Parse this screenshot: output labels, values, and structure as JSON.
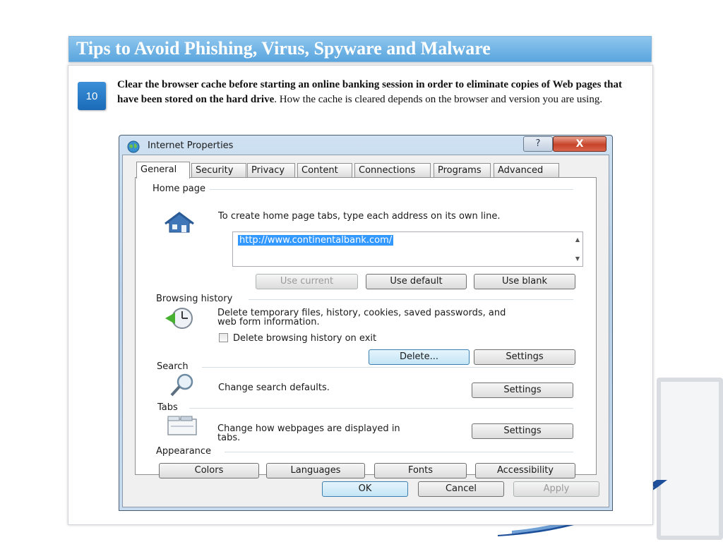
{
  "slide": {
    "title": "Tips to Avoid Phishing, Virus, Spyware and Malware",
    "tip_number": "10",
    "tip_bold": "Clear the browser cache before starting an online banking session in order to eliminate copies of Web pages that have been stored on the hard drive",
    "tip_rest": ". How the cache is cleared depends on the browser and version you are using."
  },
  "dialog": {
    "title": "Internet Properties",
    "help_button": "?",
    "close_button": "X",
    "tabs": [
      "General",
      "Security",
      "Privacy",
      "Content",
      "Connections",
      "Programs",
      "Advanced"
    ],
    "active_tab": "General",
    "home_page": {
      "label": "Home page",
      "instruction": "To create home page tabs, type each address on its own line.",
      "url": "http://www.continentalbank.com/",
      "use_current": "Use current",
      "use_default": "Use default",
      "use_blank": "Use blank"
    },
    "browsing_history": {
      "label": "Browsing history",
      "description_line1": "Delete temporary files, history, cookies, saved passwords, and",
      "description_line2": "web form information.",
      "checkbox_label": "Delete browsing history on exit",
      "checkbox_checked": false,
      "delete_button": "Delete...",
      "settings_button": "Settings"
    },
    "search": {
      "label": "Search",
      "description": "Change search defaults.",
      "settings_button": "Settings"
    },
    "tabs_section": {
      "label": "Tabs",
      "description_line1": "Change how webpages are displayed in",
      "description_line2": "tabs.",
      "settings_button": "Settings"
    },
    "appearance": {
      "label": "Appearance",
      "colors": "Colors",
      "languages": "Languages",
      "fonts": "Fonts",
      "accessibility": "Accessibility"
    },
    "footer": {
      "ok": "OK",
      "cancel": "Cancel",
      "apply": "Apply"
    }
  }
}
